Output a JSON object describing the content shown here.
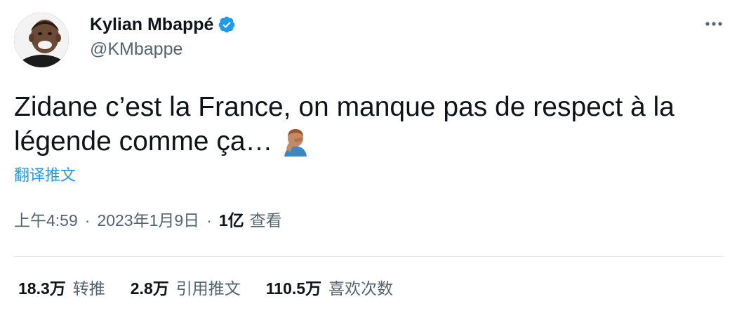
{
  "author": {
    "display_name": "Kylian Mbappé",
    "handle": "@KMbappe",
    "verified": true,
    "avatar_icon": "avatar-photo"
  },
  "tweet": {
    "text": "Zidane c’est la France, on manque pas de respect à la légende comme ça…",
    "emoji_icon": "man-facepalming-icon",
    "translate_label": "翻译推文"
  },
  "meta": {
    "time": "上午4:59",
    "separator": "·",
    "date": "2023年1月9日",
    "views_count": "1亿",
    "views_label": "查看"
  },
  "stats": [
    {
      "count": "18.3万",
      "label": "转推"
    },
    {
      "count": "2.8万",
      "label": "引用推文"
    },
    {
      "count": "110.5万",
      "label": "喜欢次数"
    }
  ],
  "colors": {
    "accent": "#1d9bf0",
    "text_primary": "#0f1419",
    "text_secondary": "#536471",
    "divider": "#e6ecf0"
  }
}
